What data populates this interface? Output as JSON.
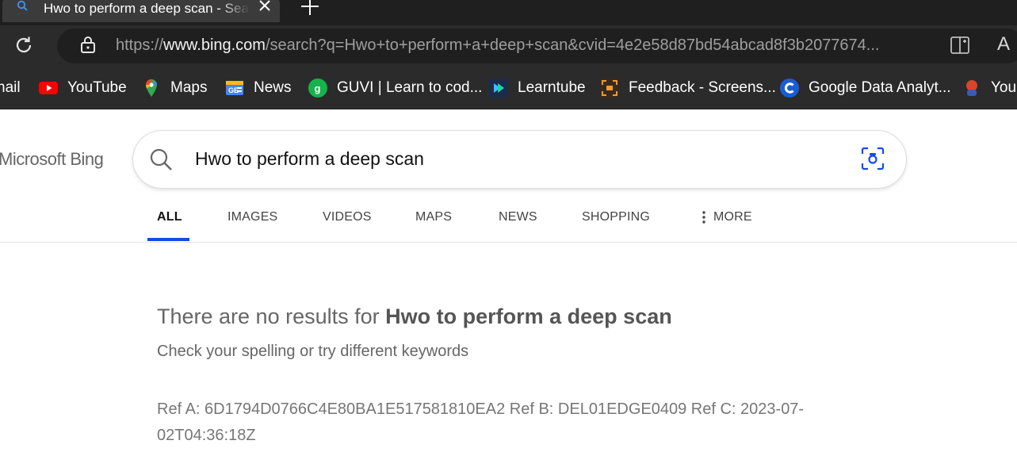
{
  "tab": {
    "title": "Hwo to perform a deep scan - Search"
  },
  "address": {
    "scheme": "https://",
    "host": "www.bing.com",
    "path": "/search?q=Hwo+to+perform+a+deep+scan&cvid=4e2e58d87bd54abcad8f3b2077674..."
  },
  "bookmarks": [
    {
      "label": "nail",
      "icon": "gmail-icon"
    },
    {
      "label": "YouTube",
      "icon": "youtube-icon"
    },
    {
      "label": "Maps",
      "icon": "maps-icon"
    },
    {
      "label": "News",
      "icon": "news-icon"
    },
    {
      "label": "GUVI | Learn to cod...",
      "icon": "guvi-icon"
    },
    {
      "label": "Learntube",
      "icon": "learntube-icon"
    },
    {
      "label": "Feedback - Screens...",
      "icon": "feedback-icon"
    },
    {
      "label": "Google Data Analyt...",
      "icon": "coursera-icon"
    },
    {
      "label": "You",
      "icon": "avatar-icon"
    }
  ],
  "bing": {
    "logo": "Microsoft Bing",
    "query": "Hwo to perform a deep scan",
    "scopes": [
      "ALL",
      "IMAGES",
      "VIDEOS",
      "MAPS",
      "NEWS",
      "SHOPPING",
      "MORE"
    ],
    "active_scope": "ALL",
    "no_results_prefix": "There are no results for ",
    "no_results_query": "Hwo to perform a deep scan",
    "hint": "Check your spelling or try different keywords",
    "ref": "Ref A: 6D1794D0766C4E80BA1E517581810EA2 Ref B: DEL01EDGE0409 Ref C: 2023-07-02T04:36:18Z"
  },
  "colors": {
    "accent": "#174ae4",
    "chrome_dark": "#2b2b2b"
  }
}
